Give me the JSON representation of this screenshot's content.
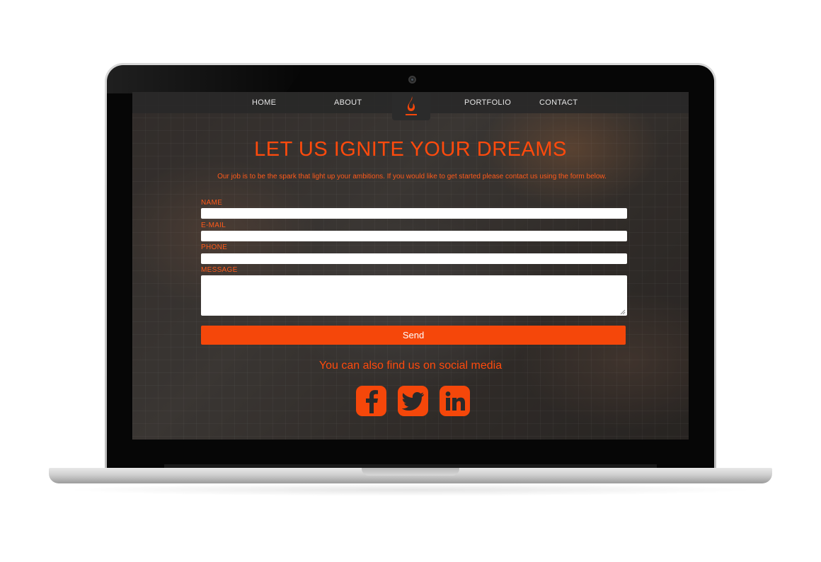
{
  "nav": {
    "items": [
      {
        "label": "HOME"
      },
      {
        "label": "ABOUT"
      },
      {
        "label": "PORTFOLIO"
      },
      {
        "label": "CONTACT"
      }
    ],
    "logo_icon": "flame-icon"
  },
  "hero": {
    "headline": "LET US IGNITE YOUR DREAMS",
    "intro": "Our job is to be the spark that light up your ambitions. If you would like to get started please contact us using the form below."
  },
  "form": {
    "name_label": "NAME",
    "name_value": "",
    "email_label": "E-MAIL",
    "email_value": "",
    "phone_label": "PHONE",
    "phone_value": "",
    "message_label": "MESSAGE",
    "message_value": "",
    "send_label": "Send"
  },
  "social": {
    "text": "You can also find us on social media",
    "icons": [
      "facebook-icon",
      "twitter-icon",
      "linkedin-icon"
    ]
  },
  "colors": {
    "accent": "#f5470a",
    "navbar": "#282828"
  }
}
